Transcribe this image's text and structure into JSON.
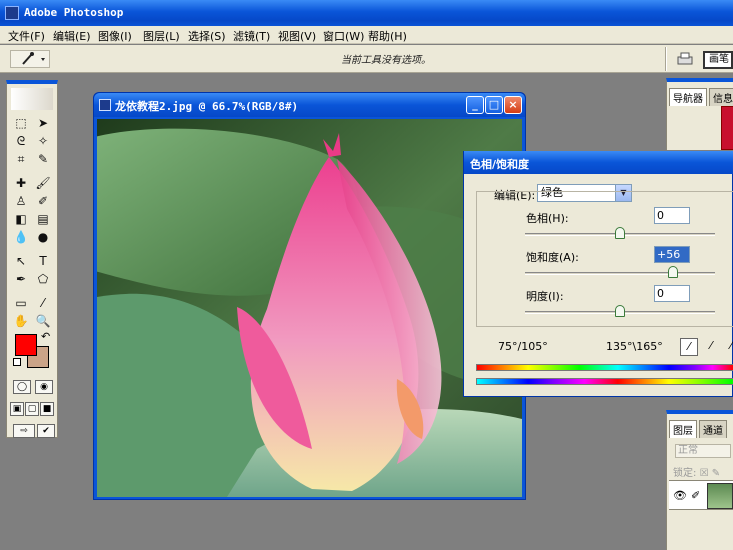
{
  "app": {
    "title": "Adobe Photoshop"
  },
  "menubar": {
    "items": [
      "文件(F)",
      "编辑(E)",
      "图像(I)",
      "图层(L)",
      "选择(S)",
      "滤镜(T)",
      "视图(V)",
      "窗口(W)",
      "帮助(H)"
    ]
  },
  "options_bar": {
    "hint": "当前工具没有选项。",
    "brush_tab": "画笔"
  },
  "toolbox": {
    "foreground_color": "#ff0000",
    "background_color": "#cba488"
  },
  "document": {
    "title": "龙依教程2.jpg @ 66.7%(RGB/8#)",
    "buttons": {
      "minimize": "minimize-icon",
      "maximize": "maximize-icon",
      "close": "close-icon"
    }
  },
  "navigator_panel": {
    "tabs": [
      "导航器",
      "信息"
    ]
  },
  "layers_panel": {
    "tabs": [
      "图层",
      "通道"
    ],
    "blend_mode": "正常",
    "lock_label": "锁定:"
  },
  "hue_saturation": {
    "title": "色相/饱和度",
    "edit_label": "编辑(E):",
    "edit_value": "绿色",
    "hue_label": "色相(H):",
    "hue_value": "0",
    "hue_level": 0.5,
    "saturation_label": "饱和度(A):",
    "saturation_value": "+56",
    "saturation_level": 0.78,
    "lightness_label": "明度(I):",
    "lightness_value": "0",
    "lightness_level": 0.5,
    "range_left": "75°/105°",
    "range_right": "135°\\165°"
  }
}
